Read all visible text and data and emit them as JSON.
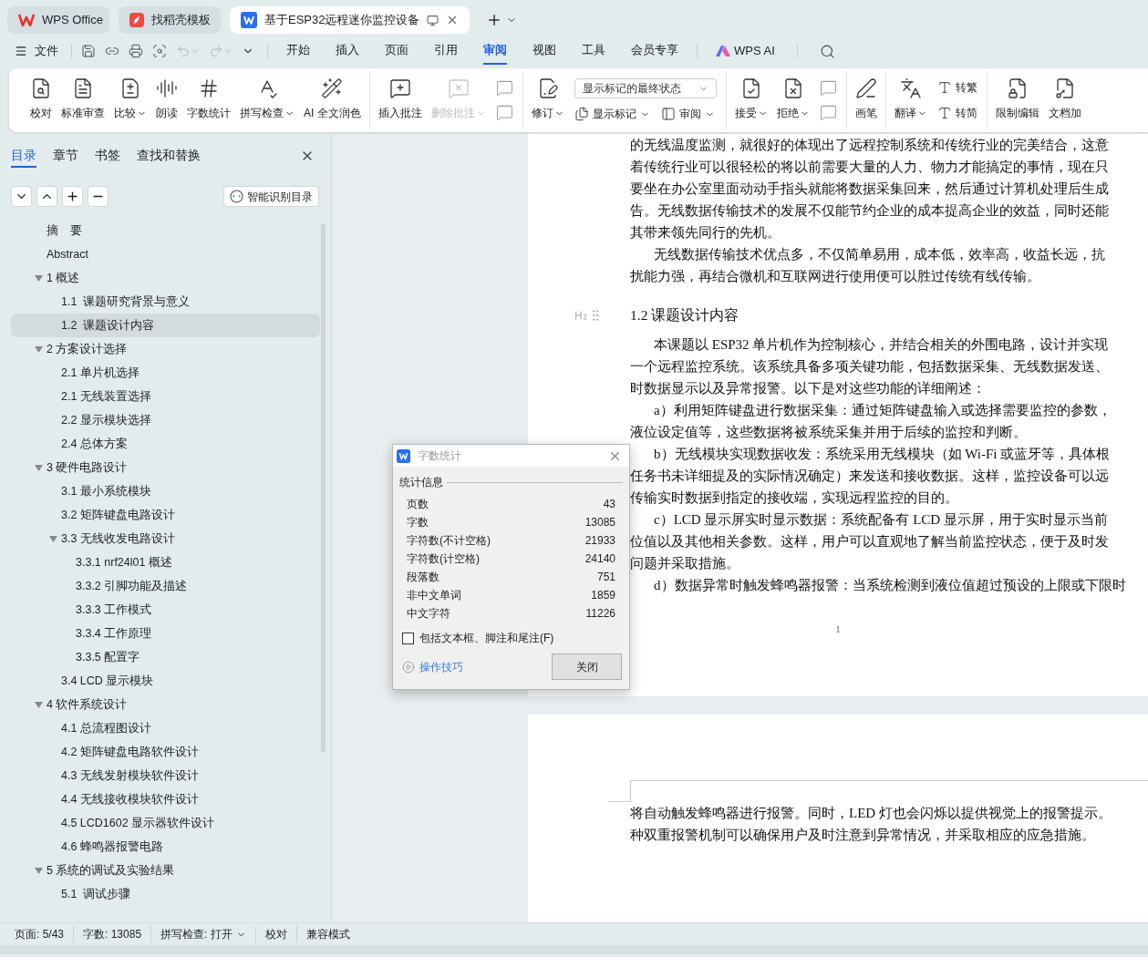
{
  "title_tabs": [
    {
      "label": "WPS Office",
      "selected": false
    },
    {
      "label": "找稻壳模板",
      "selected": false
    },
    {
      "label": "基于ESP32远程迷你监控设备",
      "selected": true
    }
  ],
  "menu": {
    "file": "文件",
    "tabs": [
      {
        "label": "开始",
        "selected": false
      },
      {
        "label": "插入",
        "selected": false
      },
      {
        "label": "页面",
        "selected": false
      },
      {
        "label": "引用",
        "selected": false
      },
      {
        "label": "审阅",
        "selected": true
      },
      {
        "label": "视图",
        "selected": false
      },
      {
        "label": "工具",
        "selected": false
      },
      {
        "label": "会员专享",
        "selected": false
      }
    ],
    "ai": "WPS AI"
  },
  "ribbon": [
    {
      "items": [
        {
          "kind": "large",
          "label": "校对",
          "dropdown": false,
          "disabled": false
        },
        {
          "kind": "large",
          "label": "标准审查",
          "dropdown": false,
          "disabled": false
        },
        {
          "kind": "large",
          "label": "比较",
          "dropdown": true,
          "disabled": false
        },
        {
          "kind": "large",
          "label": "朗读",
          "dropdown": false,
          "disabled": false
        },
        {
          "kind": "large",
          "label": "字数统计",
          "dropdown": false,
          "disabled": false
        },
        {
          "kind": "large",
          "label": "拼写检查",
          "dropdown": true,
          "disabled": false
        },
        {
          "kind": "large",
          "label": "AI 全文润色",
          "dropdown": false,
          "disabled": false
        }
      ]
    },
    {
      "items": [
        {
          "kind": "large",
          "label": "插入批注",
          "dropdown": false,
          "disabled": false
        },
        {
          "kind": "large",
          "label": "删除批注",
          "dropdown": true,
          "disabled": true
        },
        {
          "kind": "icon_pair"
        }
      ]
    },
    {
      "items": [
        {
          "kind": "large",
          "label": "修订",
          "dropdown": true,
          "disabled": false
        },
        {
          "kind": "stack",
          "select": "显示标记的最终状态",
          "items": [
            {
              "label": "显示标记",
              "dropdown": true
            },
            {
              "label": "审阅",
              "dropdown": true
            }
          ]
        }
      ]
    },
    {
      "items": [
        {
          "kind": "large",
          "label": "接受",
          "dropdown": true,
          "disabled": false
        },
        {
          "kind": "large",
          "label": "拒绝",
          "dropdown": true,
          "disabled": false
        },
        {
          "kind": "icon_pair"
        }
      ]
    },
    {
      "items": [
        {
          "kind": "large",
          "label": "画笔",
          "dropdown": false,
          "disabled": false
        }
      ]
    },
    {
      "items": [
        {
          "kind": "large",
          "label": "翻译",
          "dropdown": true,
          "disabled": false
        },
        {
          "kind": "small_column",
          "items": [
            {
              "label": "转繁"
            },
            {
              "label": "转简"
            }
          ]
        }
      ]
    },
    {
      "items": [
        {
          "kind": "large",
          "label": "限制编辑",
          "dropdown": false,
          "disabled": false
        },
        {
          "kind": "large",
          "label": "文档加",
          "dropdown": false,
          "disabled": false
        }
      ]
    }
  ],
  "sidebar": {
    "tabs": [
      {
        "label": "目录",
        "selected": true
      },
      {
        "label": "章节",
        "selected": false
      },
      {
        "label": "书签",
        "selected": false
      },
      {
        "label": "查找和替换",
        "selected": false
      }
    ],
    "smart_button": "智能识别目录",
    "outline": [
      {
        "label": "摘　要",
        "selected": false
      },
      {
        "label": "Abstract",
        "selected": false
      },
      {
        "label": "1 概述",
        "selected": false,
        "expanded": true,
        "children": [
          {
            "label": "1.1  课题研究背景与意义",
            "selected": false
          },
          {
            "label": "1.2  课题设计内容",
            "selected": true
          }
        ]
      },
      {
        "label": "2 方案设计选择",
        "selected": false,
        "expanded": true,
        "children": [
          {
            "label": "2.1 单片机选择",
            "selected": false
          },
          {
            "label": "2.1 无线装置选择",
            "selected": false
          },
          {
            "label": "2.2 显示模块选择",
            "selected": false
          },
          {
            "label": "2.4 总体方案",
            "selected": false
          }
        ]
      },
      {
        "label": "3 硬件电路设计",
        "selected": false,
        "expanded": true,
        "children": [
          {
            "label": "3.1 最小系统模块",
            "selected": false
          },
          {
            "label": "3.2 矩阵键盘电路设计",
            "selected": false
          },
          {
            "label": "3.3 无线收发电路设计",
            "selected": false,
            "expanded": true,
            "children": [
              {
                "label": "3.3.1 nrf24l01 概述",
                "selected": false
              },
              {
                "label": "3.3.2 引脚功能及描述",
                "selected": false
              },
              {
                "label": "3.3.3 工作模式",
                "selected": false
              },
              {
                "label": "3.3.4 工作原理",
                "selected": false
              },
              {
                "label": "3.3.5 配置字",
                "selected": false
              }
            ]
          },
          {
            "label": "3.4 LCD 显示模块",
            "selected": false
          }
        ]
      },
      {
        "label": "4 软件系统设计",
        "selected": false,
        "expanded": true,
        "children": [
          {
            "label": "4.1 总流程图设计",
            "selected": false
          },
          {
            "label": "4.2 矩阵键盘电路软件设计",
            "selected": false
          },
          {
            "label": "4.3 无线发射模块软件设计",
            "selected": false
          },
          {
            "label": "4.4 无线接收模块软件设计",
            "selected": false
          },
          {
            "label": "4.5 LCD1602 显示器软件设计",
            "selected": false
          },
          {
            "label": "4.6 蜂鸣器报警电路",
            "selected": false
          }
        ]
      },
      {
        "label": "5 系统的调试及实验结果",
        "selected": false,
        "expanded": true,
        "children": [
          {
            "label": "5.1  调试步骤",
            "selected": false
          }
        ]
      }
    ]
  },
  "document": {
    "pages": [
      {
        "blocks": [
          {
            "kind": "paragraph",
            "continued": true,
            "lines": [
              "的无线温度监测，就很好的体现出了远程控制系统和传统行业的完美结合，这意",
              "着传统行业可以很轻松的将以前需要大量的人力、物力才能搞定的事情，现在只",
              "要坐在办公室里面动动手指头就能将数据采集回来，然后通过计算机处理后生成",
              "告。无线数据传输技术的发展不仅能节约企业的成本提高企业的效益，同时还能",
              "其带来领先同行的先机。"
            ]
          },
          {
            "kind": "paragraph",
            "continued": false,
            "lines": [
              "无线数据传输技术优点多，不仅简单易用，成本低，效率高，收益长远，抗",
              "扰能力强，再结合微机和互联网进行使用便可以胜过传统有线传输。"
            ]
          },
          {
            "kind": "heading",
            "text": "1.2  课题设计内容"
          },
          {
            "kind": "paragraph",
            "continued": false,
            "lines": [
              "本课题以 ESP32 单片机作为控制核心，并结合相关的外围电路，设计并实现",
              "一个远程监控系统。该系统具备多项关键功能，包括数据采集、无线数据发送、",
              "时数据显示以及异常报警。以下是对这些功能的详细阐述："
            ]
          },
          {
            "kind": "paragraph",
            "continued": false,
            "lines": [
              "a）利用矩阵键盘进行数据采集：通过矩阵键盘输入或选择需要监控的参数，",
              "液位设定值等，这些数据将被系统采集并用于后续的监控和判断。"
            ]
          },
          {
            "kind": "paragraph",
            "continued": false,
            "lines": [
              "b）无线模块实现数据收发：系统采用无线模块（如 Wi-Fi 或蓝牙等，具体根",
              "任务书未详细提及的实际情况确定）来发送和接收数据。这样，监控设备可以远",
              "传输实时数据到指定的接收端，实现远程监控的目的。"
            ]
          },
          {
            "kind": "paragraph",
            "continued": false,
            "lines": [
              "c）LCD 显示屏实时显示数据：系统配备有 LCD 显示屏，用于实时显示当前",
              "位值以及其他相关参数。这样，用户可以直观地了解当前监控状态，便于及时发",
              "问题并采取措施。"
            ]
          },
          {
            "kind": "paragraph",
            "continued": false,
            "lines": [
              "d）数据异常时触发蜂鸣器报警：当系统检测到液位值超过预设的上限或下限时"
            ]
          }
        ],
        "page_number": "1"
      },
      {
        "blocks": [
          {
            "kind": "paragraph",
            "continued": true,
            "lines": [
              "将自动触发蜂鸣器进行报警。同时，LED 灯也会闪烁以提供视觉上的报警提示。",
              "种双重报警机制可以确保用户及时注意到异常情况，并采取相应的应急措施。"
            ]
          }
        ]
      }
    ]
  },
  "dialog": {
    "title": "字数统计",
    "group": "统计信息",
    "stats": [
      {
        "label": "页数",
        "value": "43"
      },
      {
        "label": "字数",
        "value": "13085"
      },
      {
        "label": "字符数(不计空格)",
        "value": "21933"
      },
      {
        "label": "字符数(计空格)",
        "value": "24140"
      },
      {
        "label": "段落数",
        "value": "751"
      },
      {
        "label": "非中文单词",
        "value": "1859"
      },
      {
        "label": "中文字符",
        "value": "11226"
      }
    ],
    "include_option": {
      "label": "包括文本框、脚注和尾注(F)",
      "checked": false
    },
    "tips_link": "操作技巧",
    "close_button": "关闭"
  },
  "status_bar": [
    {
      "label": "页面: 5/43",
      "dropdown": false
    },
    {
      "label": "字数: 13085",
      "dropdown": false
    },
    {
      "label": "拼写检查: 打开",
      "dropdown": true
    },
    {
      "label": "校对",
      "dropdown": false
    },
    {
      "label": "兼容模式",
      "dropdown": false
    }
  ]
}
